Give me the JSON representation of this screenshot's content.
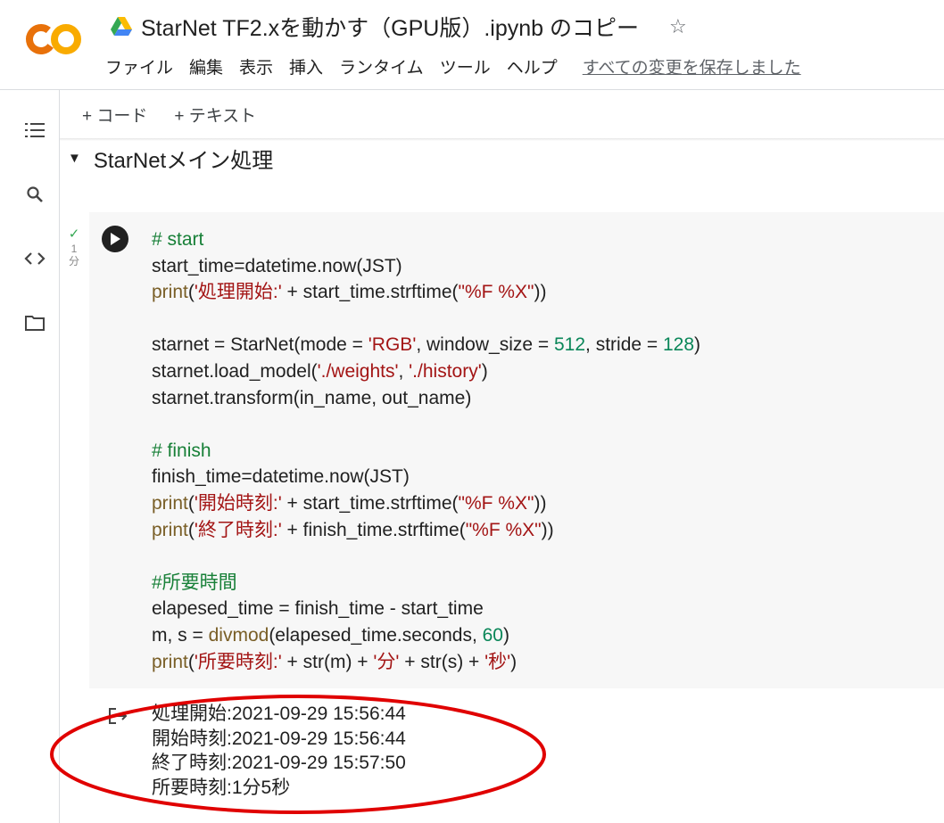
{
  "header": {
    "logo_text": "CO",
    "drive_icon": "google-drive-icon",
    "title": "StarNet TF2.xを動かす（GPU版）.ipynb のコピー",
    "star_icon": "star-outline-icon",
    "menu": [
      "ファイル",
      "編集",
      "表示",
      "挿入",
      "ランタイム",
      "ツール",
      "ヘルプ"
    ],
    "save_status": "すべての変更を保存しました"
  },
  "sidebar": {
    "icons": [
      "toc-icon",
      "search-icon",
      "code-snippets-icon",
      "folder-icon"
    ]
  },
  "toolbar": {
    "add_code": "+ コード",
    "add_text": "+ テキスト"
  },
  "section": {
    "title": "StarNetメイン処理"
  },
  "cell": {
    "status_check": "✓",
    "exec_time": "1\n分",
    "code_lines": [
      [
        {
          "t": "# start",
          "c": "com"
        }
      ],
      [
        {
          "t": "start_time=datetime.now(JST)"
        }
      ],
      [
        {
          "t": "print",
          "c": "fn"
        },
        {
          "t": "("
        },
        {
          "t": "'処理開始:'",
          "c": "str"
        },
        {
          "t": " + start_time.strftime("
        },
        {
          "t": "\"%F %X\"",
          "c": "str"
        },
        {
          "t": "))"
        }
      ],
      [],
      [
        {
          "t": "starnet = StarNet(mode = "
        },
        {
          "t": "'RGB'",
          "c": "str"
        },
        {
          "t": ", window_size = "
        },
        {
          "t": "512",
          "c": "num"
        },
        {
          "t": ", stride = "
        },
        {
          "t": "128",
          "c": "num"
        },
        {
          "t": ")"
        }
      ],
      [
        {
          "t": "starnet.load_model("
        },
        {
          "t": "'./weights'",
          "c": "str"
        },
        {
          "t": ", "
        },
        {
          "t": "'./history'",
          "c": "str"
        },
        {
          "t": ")"
        }
      ],
      [
        {
          "t": "starnet.transform(in_name, out_name)"
        }
      ],
      [],
      [
        {
          "t": "# finish",
          "c": "com"
        }
      ],
      [
        {
          "t": "finish_time=datetime.now(JST)"
        }
      ],
      [
        {
          "t": "print",
          "c": "fn"
        },
        {
          "t": "("
        },
        {
          "t": "'開始時刻:'",
          "c": "str"
        },
        {
          "t": " + start_time.strftime("
        },
        {
          "t": "\"%F %X\"",
          "c": "str"
        },
        {
          "t": "))"
        }
      ],
      [
        {
          "t": "print",
          "c": "fn"
        },
        {
          "t": "("
        },
        {
          "t": "'終了時刻:'",
          "c": "str"
        },
        {
          "t": " + finish_time.strftime("
        },
        {
          "t": "\"%F %X\"",
          "c": "str"
        },
        {
          "t": "))"
        }
      ],
      [],
      [
        {
          "t": "#所要時間",
          "c": "com"
        }
      ],
      [
        {
          "t": "elapesed_time = finish_time - start_time"
        }
      ],
      [
        {
          "t": "m, s = "
        },
        {
          "t": "divmod",
          "c": "fn"
        },
        {
          "t": "(elapesed_time.seconds, "
        },
        {
          "t": "60",
          "c": "num"
        },
        {
          "t": ")"
        }
      ],
      [
        {
          "t": "print",
          "c": "fn"
        },
        {
          "t": "("
        },
        {
          "t": "'所要時刻:'",
          "c": "str"
        },
        {
          "t": " + str(m) + "
        },
        {
          "t": "'分'",
          "c": "str"
        },
        {
          "t": " + str(s) + "
        },
        {
          "t": "'秒'",
          "c": "str"
        },
        {
          "t": ")"
        }
      ]
    ]
  },
  "output": {
    "icon": "output-redirect-icon",
    "lines": [
      "処理開始:2021-09-29 15:56:44",
      "開始時刻:2021-09-29 15:56:44",
      "終了時刻:2021-09-29 15:57:50",
      "所要時刻:1分5秒"
    ]
  },
  "colors": {
    "logo_orange": "#f9ab00",
    "logo_red_orange": "#e8710a",
    "comment": "#188038",
    "function": "#795e26",
    "string": "#a31515",
    "number": "#098658",
    "annotation_ellipse": "#e00000"
  }
}
